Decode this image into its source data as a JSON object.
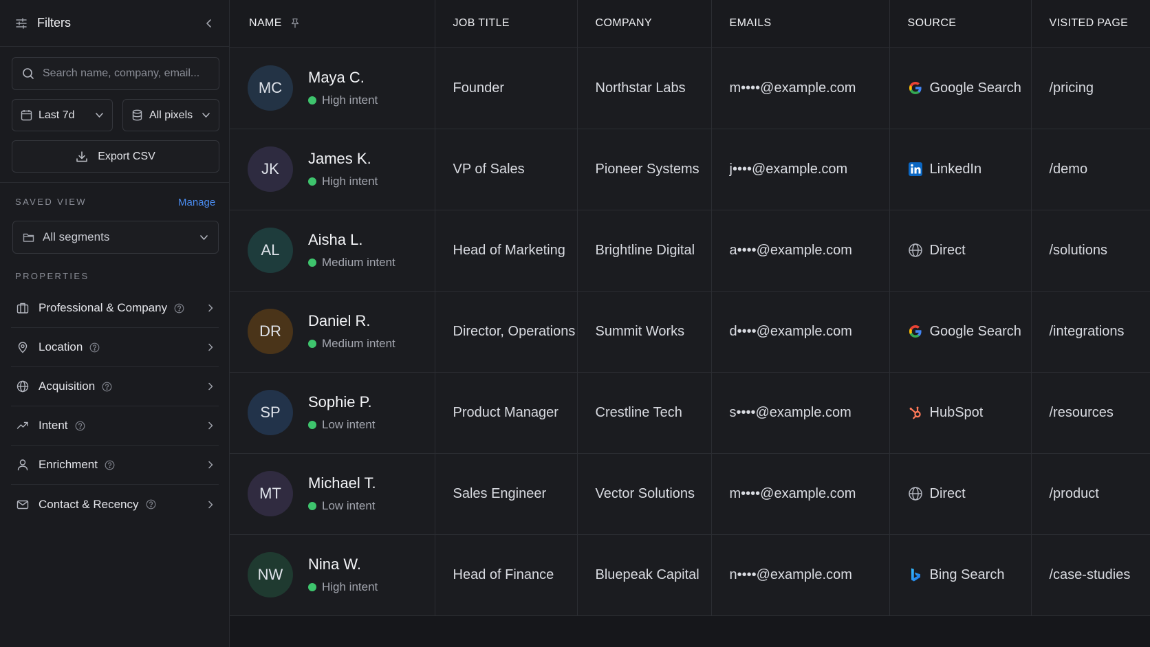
{
  "sidebar": {
    "title": "Filters",
    "search_placeholder": "Search name, company, email...",
    "date_filter": "Last 7d",
    "pixel_filter": "All pixels",
    "export_label": "Export CSV",
    "saved_view_title": "SAVED VIEW",
    "manage_label": "Manage",
    "segment_value": "All segments",
    "properties_title": "PROPERTIES",
    "properties": [
      {
        "label": "Professional & Company",
        "icon": "building-icon"
      },
      {
        "label": "Location",
        "icon": "location-pin-icon"
      },
      {
        "label": "Acquisition",
        "icon": "globe-icon"
      },
      {
        "label": "Intent",
        "icon": "trend-up-icon"
      },
      {
        "label": "Enrichment",
        "icon": "user-icon"
      },
      {
        "label": "Contact & Recency",
        "icon": "mail-icon"
      }
    ]
  },
  "table": {
    "columns": [
      "NAME",
      "JOB TITLE",
      "COMPANY",
      "EMAILS",
      "SOURCE",
      "VISITED PAGE"
    ],
    "rows": [
      {
        "initials": "MC",
        "avatar_color": "#233345",
        "name": "Maya C.",
        "intent": "High intent",
        "job": "Founder",
        "company": "Northstar Labs",
        "email": "m••••@example.com",
        "source": "Google Search",
        "source_icon": "google-icon",
        "page": "/pricing"
      },
      {
        "initials": "JK",
        "avatar_color": "#2e2b40",
        "name": "James K.",
        "intent": "High intent",
        "job": "VP of Sales",
        "company": "Pioneer Systems",
        "email": "j••••@example.com",
        "source": "LinkedIn",
        "source_icon": "linkedin-icon",
        "page": "/demo"
      },
      {
        "initials": "AL",
        "avatar_color": "#1e3c3c",
        "name": "Aisha L.",
        "intent": "Medium intent",
        "job": "Head of Marketing",
        "company": "Brightline Digital",
        "email": "a••••@example.com",
        "source": "Direct",
        "source_icon": "globe-icon",
        "page": "/solutions"
      },
      {
        "initials": "DR",
        "avatar_color": "#4a3419",
        "name": "Daniel R.",
        "intent": "Medium intent",
        "job": "Director, Operations",
        "company": "Summit Works",
        "email": "d••••@example.com",
        "source": "Google Search",
        "source_icon": "google-icon",
        "page": "/integrations"
      },
      {
        "initials": "SP",
        "avatar_color": "#22334a",
        "name": "Sophie P.",
        "intent": "Low intent",
        "job": "Product Manager",
        "company": "Crestline Tech",
        "email": "s••••@example.com",
        "source": "HubSpot",
        "source_icon": "hubspot-icon",
        "page": "/resources"
      },
      {
        "initials": "MT",
        "avatar_color": "#302b40",
        "name": "Michael T.",
        "intent": "Low intent",
        "job": "Sales Engineer",
        "company": "Vector Solutions",
        "email": "m••••@example.com",
        "source": "Direct",
        "source_icon": "globe-icon",
        "page": "/product"
      },
      {
        "initials": "NW",
        "avatar_color": "#1f3a30",
        "name": "Nina W.",
        "intent": "High intent",
        "job": "Head of Finance",
        "company": "Bluepeak Capital",
        "email": "n••••@example.com",
        "source": "Bing Search",
        "source_icon": "bing-icon",
        "page": "/case-studies"
      }
    ]
  },
  "colors": {
    "accent": "#4a8cf0",
    "intent_dot": "#3ec46d"
  }
}
